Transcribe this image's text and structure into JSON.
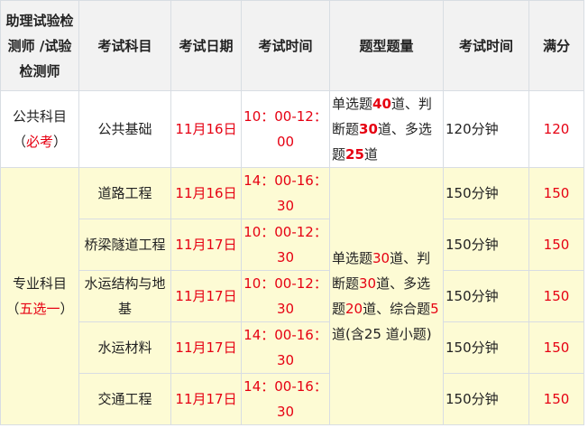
{
  "headers": {
    "category": "助理试验检测师 /试验检测师",
    "subject": "考试科目",
    "date": "考试日期",
    "time": "考试时间",
    "questions": "题型题量",
    "duration": "考试时间",
    "full_score": "满分"
  },
  "public": {
    "category_label": "公共科目",
    "category_paren_open": "（",
    "category_note": "必考",
    "category_paren_close": "）",
    "subject": "公共基础",
    "date": "11月16日",
    "time": "10：00-12：00",
    "q_a": "单选题",
    "q_a_num": "40",
    "q_b": "道、判断题",
    "q_b_num": "30",
    "q_c": "道、多选题",
    "q_c_num": "25",
    "q_d": "道",
    "duration": "120分钟",
    "score": "120"
  },
  "professional": {
    "category_label": "专业科目",
    "category_paren_open": "（",
    "category_note": "五选一",
    "category_paren_close": "）",
    "q_a": "单选题",
    "q_a_num": "30",
    "q_b": "道、判断题",
    "q_b_num": "30",
    "q_c": "道、多选题",
    "q_c_num": "20",
    "q_d": "道、综合题",
    "q_d_num": "5",
    "q_e": "道(含25 道小题)",
    "rows": [
      {
        "subject": "道路工程",
        "date": "11月16日",
        "time": "14：00-16：30",
        "duration": "150分钟",
        "score": "150"
      },
      {
        "subject": "桥梁隧道工程",
        "date": "11月17日",
        "time": "10：00-12：30",
        "duration": "150分钟",
        "score": "150"
      },
      {
        "subject": "水运结构与地基",
        "date": "11月17日",
        "time": "10：00-12：30",
        "duration": "150分钟",
        "score": "150"
      },
      {
        "subject": "水运材料",
        "date": "11月17日",
        "time": "14：00-16：30",
        "duration": "150分钟",
        "score": "150"
      },
      {
        "subject": "交通工程",
        "date": "11月17日",
        "time": "14：00-16：30",
        "duration": "150分钟",
        "score": "150"
      }
    ]
  }
}
